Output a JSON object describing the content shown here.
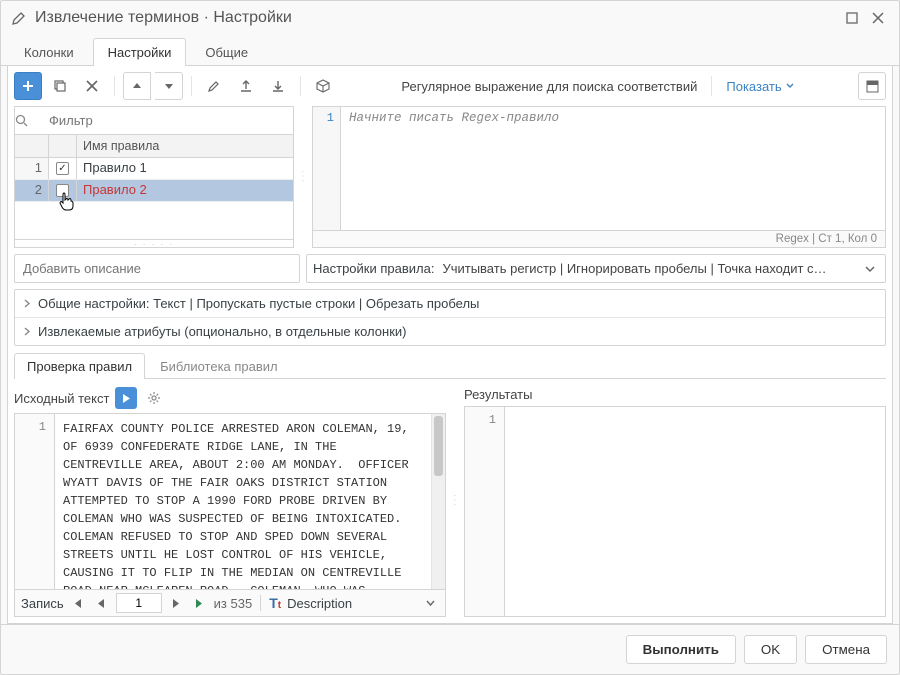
{
  "titlebar": {
    "title": "Извлечение терминов · Настройки"
  },
  "tabs": {
    "columns": "Колонки",
    "settings": "Настройки",
    "general": "Общие"
  },
  "toolbar": {
    "regex_label": "Регулярное выражение для поиска соответствий",
    "show_label": "Показать"
  },
  "filter": {
    "placeholder": "Фильтр"
  },
  "grid": {
    "header": "Имя правила",
    "rows": [
      {
        "num": "1",
        "checked": true,
        "name": "Правило 1"
      },
      {
        "num": "2",
        "checked": false,
        "name": "Правило 2"
      }
    ]
  },
  "regex": {
    "line": "1",
    "placeholder": "Начните писать Regex-правило",
    "status": "Regex | Ст 1, Кол 0"
  },
  "description": {
    "placeholder": "Добавить описание"
  },
  "rule_settings": {
    "label": "Настройки правила:",
    "options_text": "Учитывать регистр | Игнорировать пробелы | Точка находит с…"
  },
  "accordion": {
    "general": "Общие настройки: Текст | Пропускать пустые строки | Обрезать пробелы",
    "attrs": "Извлекаемые атрибуты (опционально, в отдельные колонки)"
  },
  "subtabs": {
    "check": "Проверка правил",
    "library": "Библиотека правил"
  },
  "source": {
    "label": "Исходный текст",
    "line": "1",
    "text": "FAIRFAX COUNTY POLICE ARRESTED ARON COLEMAN, 19, OF 6939 CONFEDERATE RIDGE LANE, IN THE CENTREVILLE AREA, ABOUT 2:00 AM MONDAY.  OFFICER WYATT DAVIS OF THE FAIR OAKS DISTRICT STATION ATTEMPTED TO STOP A 1990 FORD PROBE DRIVEN BY COLEMAN WHO WAS SUSPECTED OF BEING INTOXICATED.  COLEMAN REFUSED TO STOP AND SPED DOWN SEVERAL STREETS UNTIL HE LOST CONTROL OF HIS VEHICLE, CAUSING IT TO FLIP IN THE MEDIAN ON CENTREVILLE ROAD NEAR MCLEAREN ROAD.  COLEMAN, WHO WAS PARTIALLY EJECTED,"
  },
  "results": {
    "label": "Результаты",
    "line": "1"
  },
  "record_nav": {
    "label": "Запись",
    "current": "1",
    "of": "из 535",
    "field": "Description"
  },
  "footer": {
    "run": "Выполнить",
    "ok": "OK",
    "cancel": "Отмена"
  }
}
